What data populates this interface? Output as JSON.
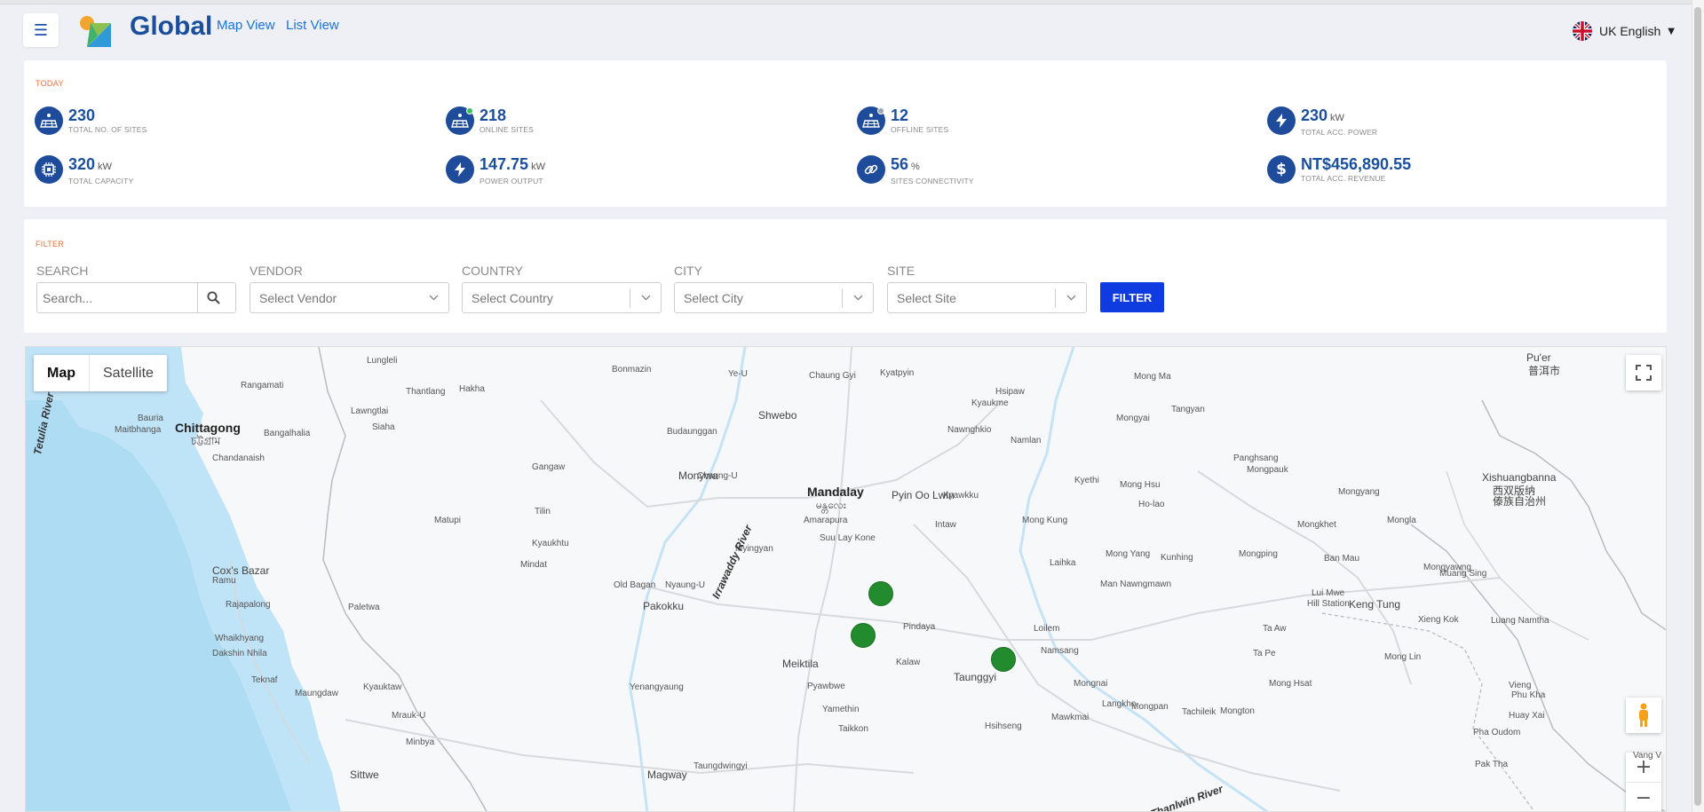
{
  "header": {
    "brand": "Global",
    "nav": [
      "Map View",
      "List View"
    ],
    "language": "UK English"
  },
  "today": {
    "title": "TODAY",
    "stats": [
      {
        "value": "230",
        "unit": "",
        "label": "TOTAL NO. OF SITES",
        "icon": "solar-panel-icon"
      },
      {
        "value": "218",
        "unit": "",
        "label": "ONLINE SITES",
        "icon": "solar-online-icon"
      },
      {
        "value": "12",
        "unit": "",
        "label": "OFFLINE SITES",
        "icon": "solar-offline-icon"
      },
      {
        "value": "230",
        "unit": "kW",
        "label": "TOTAL ACC. POWER",
        "icon": "lightning-icon"
      },
      {
        "value": "320",
        "unit": "kW",
        "label": "TOTAL CAPACITY",
        "icon": "chip-icon"
      },
      {
        "value": "147.75",
        "unit": "kW",
        "label": "POWER OUTPUT",
        "icon": "lightning-icon"
      },
      {
        "value": "56",
        "unit": "%",
        "label": "SITES CONNECTIVITY",
        "icon": "link-icon"
      },
      {
        "value": "NT$456,890.55",
        "unit": "",
        "label": "TOTAL ACC. REVENUE",
        "icon": "dollar-icon"
      }
    ]
  },
  "filter": {
    "title": "FILTER",
    "search_label": "SEARCH",
    "search_placeholder": "Search...",
    "vendor_label": "VENDOR",
    "vendor_value": "Select Vendor",
    "country_label": "COUNTRY",
    "country_value": "Select Country",
    "city_label": "CITY",
    "city_value": "Select City",
    "site_label": "SITE",
    "site_value": "Select Site",
    "button": "FILTER"
  },
  "map": {
    "toggle": [
      "Map",
      "Satellite"
    ],
    "places": [
      {
        "t": "Chittagong",
        "c": "big"
      },
      {
        "t": "চট্টগ্রাম",
        "c": "med"
      },
      {
        "t": "Mandalay",
        "c": "big"
      },
      {
        "t": "မန္တလေး",
        "c": "med"
      },
      {
        "t": "Pyin Oo Lwin",
        "c": "med"
      },
      {
        "t": "Taunggyi",
        "c": "med"
      },
      {
        "t": "Meiktila",
        "c": "med"
      },
      {
        "t": "Monywa",
        "c": "med"
      },
      {
        "t": "Shwebo",
        "c": "med"
      },
      {
        "t": "Pakokku",
        "c": "med"
      },
      {
        "t": "Magway",
        "c": "med"
      },
      {
        "t": "Sittwe",
        "c": "med"
      },
      {
        "t": "Cox's Bazar",
        "c": "med"
      },
      {
        "t": "Xishuangbanna",
        "c": "med"
      },
      {
        "t": "西双版纳",
        "c": "med"
      },
      {
        "t": "傣族自治州",
        "c": "med"
      },
      {
        "t": "Pu'er",
        "c": "med"
      },
      {
        "t": "普洱市",
        "c": "med"
      },
      {
        "t": "Keng Tung",
        "c": "med"
      },
      {
        "t": "Lungleli",
        "c": ""
      },
      {
        "t": "Rangamati",
        "c": ""
      },
      {
        "t": "Thantlang",
        "c": ""
      },
      {
        "t": "Hakha",
        "c": ""
      },
      {
        "t": "Lawngtlai",
        "c": ""
      },
      {
        "t": "Siaha",
        "c": ""
      },
      {
        "t": "Bauria",
        "c": ""
      },
      {
        "t": "Maitbhanga",
        "c": ""
      },
      {
        "t": "Bangalhalia",
        "c": ""
      },
      {
        "t": "Chandanaish",
        "c": ""
      },
      {
        "t": "Matupi",
        "c": ""
      },
      {
        "t": "Paletwa",
        "c": ""
      },
      {
        "t": "Ramu",
        "c": ""
      },
      {
        "t": "Rajapalong",
        "c": ""
      },
      {
        "t": "Whaikhyang",
        "c": ""
      },
      {
        "t": "Dakshin Nhila",
        "c": ""
      },
      {
        "t": "Teknaf",
        "c": ""
      },
      {
        "t": "Maungdaw",
        "c": ""
      },
      {
        "t": "Kyauktaw",
        "c": ""
      },
      {
        "t": "Mrauk-U",
        "c": ""
      },
      {
        "t": "Minbya",
        "c": ""
      },
      {
        "t": "Bonmazin",
        "c": ""
      },
      {
        "t": "Ye-U",
        "c": ""
      },
      {
        "t": "Chaung Gyi",
        "c": ""
      },
      {
        "t": "Kyatpyin",
        "c": ""
      },
      {
        "t": "Hsipaw",
        "c": ""
      },
      {
        "t": "Kyaukme",
        "c": ""
      },
      {
        "t": "Nawnghkio",
        "c": ""
      },
      {
        "t": "Namlan",
        "c": ""
      },
      {
        "t": "Mong Ma",
        "c": ""
      },
      {
        "t": "Mongyai",
        "c": ""
      },
      {
        "t": "Tangyan",
        "c": ""
      },
      {
        "t": "Budaunggan",
        "c": ""
      },
      {
        "t": "Gangaw",
        "c": ""
      },
      {
        "t": "Chaung-U",
        "c": ""
      },
      {
        "t": "Amarapura",
        "c": ""
      },
      {
        "t": "Kyawkku",
        "c": ""
      },
      {
        "t": "Kyethi",
        "c": ""
      },
      {
        "t": "Mong Hsu",
        "c": ""
      },
      {
        "t": "Ho-lao",
        "c": ""
      },
      {
        "t": "Panghsang",
        "c": ""
      },
      {
        "t": "Mongpauk",
        "c": ""
      },
      {
        "t": "Mongyang",
        "c": ""
      },
      {
        "t": "Tilin",
        "c": ""
      },
      {
        "t": "Kyaukhtu",
        "c": ""
      },
      {
        "t": "Suu Lay Kone",
        "c": ""
      },
      {
        "t": "Myingyan",
        "c": ""
      },
      {
        "t": "Intaw",
        "c": ""
      },
      {
        "t": "Mong Kung",
        "c": ""
      },
      {
        "t": "Mongkhet",
        "c": ""
      },
      {
        "t": "Mongla",
        "c": ""
      },
      {
        "t": "Mindat",
        "c": ""
      },
      {
        "t": "Old Bagan",
        "c": ""
      },
      {
        "t": "Nyaung-U",
        "c": ""
      },
      {
        "t": "Laihka",
        "c": ""
      },
      {
        "t": "Mong Yang",
        "c": ""
      },
      {
        "t": "Kunhing",
        "c": ""
      },
      {
        "t": "Mongping",
        "c": ""
      },
      {
        "t": "Ban Mau",
        "c": ""
      },
      {
        "t": "Mongyawng",
        "c": ""
      },
      {
        "t": "Muang Sing",
        "c": ""
      },
      {
        "t": "Man Nawngmawn",
        "c": ""
      },
      {
        "t": "Lui Mwe",
        "c": ""
      },
      {
        "t": "Hill Station",
        "c": ""
      },
      {
        "t": "Ta Aw",
        "c": ""
      },
      {
        "t": "Pindaya",
        "c": ""
      },
      {
        "t": "Loilem",
        "c": ""
      },
      {
        "t": "Xieng Kok",
        "c": ""
      },
      {
        "t": "Luang Namtha",
        "c": ""
      },
      {
        "t": "Namsang",
        "c": ""
      },
      {
        "t": "Ta Pe",
        "c": ""
      },
      {
        "t": "Mong Lin",
        "c": ""
      },
      {
        "t": "Kalaw",
        "c": ""
      },
      {
        "t": "Pyawbwe",
        "c": ""
      },
      {
        "t": "Yenangyaung",
        "c": ""
      },
      {
        "t": "Yamethin",
        "c": ""
      },
      {
        "t": "Mongnai",
        "c": ""
      },
      {
        "t": "Mong Hsat",
        "c": ""
      },
      {
        "t": "Tachileik",
        "c": ""
      },
      {
        "t": "Vieng",
        "c": ""
      },
      {
        "t": "Phu Kha",
        "c": ""
      },
      {
        "t": "Langkho",
        "c": ""
      },
      {
        "t": "Mongpan",
        "c": ""
      },
      {
        "t": "Mongton",
        "c": ""
      },
      {
        "t": "Huay Xai",
        "c": ""
      },
      {
        "t": "Pha Oudom",
        "c": ""
      },
      {
        "t": "Mawkmai",
        "c": ""
      },
      {
        "t": "Hsihseng",
        "c": ""
      },
      {
        "t": "Taikkon",
        "c": ""
      },
      {
        "t": "Taungdwingyi",
        "c": ""
      },
      {
        "t": "Pak Tha",
        "c": ""
      },
      {
        "t": "Vang V",
        "c": ""
      }
    ],
    "rivers": [
      "Irrawaddy River",
      "Tetulia River",
      "Thanlwin River"
    ],
    "sites": 3
  },
  "colors": {
    "accent": "#1b4f9c",
    "brand_icon": "#1f4c9a",
    "section_title": "#e8733a",
    "filter_button": "#0f3ce0",
    "marker": "#228b2e"
  }
}
